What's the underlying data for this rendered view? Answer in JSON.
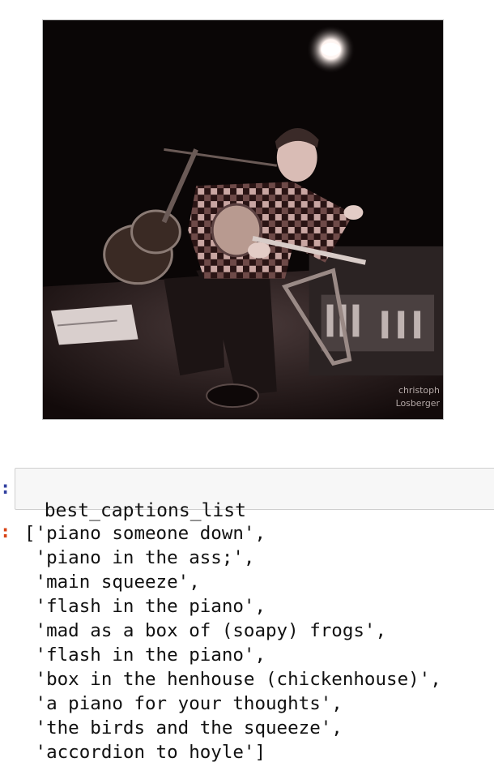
{
  "image": {
    "watermark": "christoph Losberger"
  },
  "input_cell": {
    "code": "best_captions_list"
  },
  "output": {
    "lines": [
      "['piano someone down',",
      " 'piano in the ass;',",
      " 'main squeeze',",
      " 'flash in the piano',",
      " 'mad as a box of (soapy) frogs',",
      " 'flash in the piano',",
      " 'box in the henhouse (chickenhouse)',",
      " 'a piano for your thoughts',",
      " 'the birds and the squeeze',",
      " 'accordion to hoyle']"
    ]
  }
}
